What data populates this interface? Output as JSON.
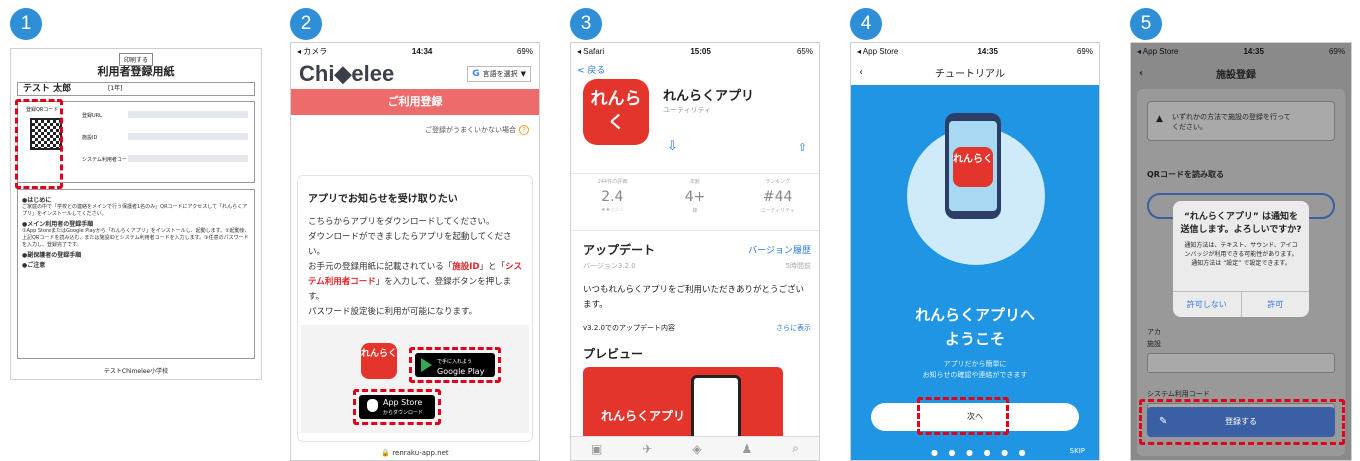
{
  "steps": [
    "1",
    "2",
    "3",
    "4",
    "5"
  ],
  "p1": {
    "print_button": "印刷する",
    "title": "利用者登録用紙",
    "user_name": "テスト 太郎",
    "user_tag": "[1年]",
    "qr_label": "登録QRコード",
    "field_1": "登録URL",
    "field_2": "施設ID",
    "field_3": "システム利用者コード",
    "intro_heading": "●はじめに",
    "intro_text": "ご家庭の中で「学校との連絡をメインで行う保護者1名のみ」QRコードにアクセスして「れんらくアプリ」をインストールしてください。",
    "main_heading": "●メイン利用者の登録手順",
    "main_text": "①App StoreまたはGoogle Playから「れんらくアプリ」をインストールし、起動します。②起動後、上記QRコードを読み込む、または施設IDとシステム利用者コードを入力します。③任意のパスワードを入力し、登録完了です。",
    "sub_heading": "●副保護者の登録手順",
    "note_heading": "●ご注意",
    "footer": "テストChimelee小学校"
  },
  "p2": {
    "time": "14:34",
    "carrier": "◂ カメラ",
    "battery": "69%",
    "logo": "Chi◆elee",
    "lang_button": "言語を選択",
    "header_bar": "ご利用登録",
    "help_link": "ご登録がうまくいかない場合",
    "card_title": "アプリでお知らせを受け取りたい",
    "para_1": "こちらからアプリをダウンロードしてください。",
    "para_2": "ダウンロードができましたらアプリを起動してください。",
    "para_3a": "お手元の登録用紙に記載されている「",
    "para_3_id": "施設ID",
    "para_3b": "」と「",
    "para_3_code": "システム利用者コード",
    "para_3c": "」を入力して、登録ボタンを押します。",
    "para_4": "パスワード設定後に利用が可能になります。",
    "app_icon": "れんらく",
    "google_play": "Google Play",
    "google_play_sub": "で手に入れよう",
    "app_store": "App Store",
    "app_store_sub": "からダウンロード",
    "url": "🔒 renraku-app.net"
  },
  "p3": {
    "time": "15:05",
    "carrier": "◂ Safari",
    "battery": "65%",
    "back": "< 戻る",
    "icon_text": "れんらく",
    "app_name": "れんらくアプリ",
    "category": "ユーティリティ",
    "stats": [
      {
        "label": "244件の評価",
        "value": "2.4",
        "sub": "★★☆☆☆"
      },
      {
        "label": "年齢",
        "value": "4+",
        "sub": "歳"
      },
      {
        "label": "ランキング",
        "value": "#44",
        "sub": "ユーティリティ"
      }
    ],
    "update_title": "アップデート",
    "history": "バージョン履歴",
    "version": "バージョン3.2.0",
    "ago": "5時間前",
    "note": "いつもれんらくアプリをご利用いただきありがとうございます。",
    "version_note": "v3.2.0でのアップデート内容",
    "more": "さらに表示",
    "preview": "プレビュー",
    "preview_text": "れんらくアプリ"
  },
  "p4": {
    "time": "14:35",
    "carrier": "◂ App Store",
    "battery": "69%",
    "nav_title": "チュートリアル",
    "app_logo": "れんらく",
    "welcome_1": "れんらくアプリへ",
    "welcome_2": "ようこそ",
    "sub_1": "アプリだから簡単に",
    "sub_2": "お知らせの確認や連絡ができます",
    "next_button": "次へ",
    "dots": "● ● ● ● ● ●",
    "skip": "SKIP"
  },
  "p5": {
    "time": "14:35",
    "carrier": "◂ App Store",
    "battery": "69%",
    "nav_title": "施設登録",
    "warning_1": "いずれかの方法で施設の登録を行って",
    "warning_2": "ください。",
    "qr_title": "QRコードを読み取る",
    "dialog_title_1": "“れんらくアプリ” は通知を",
    "dialog_title_2": "送信します。よろしいですか?",
    "dialog_body_1": "通知方法は、テキスト、サウンド、アイコ",
    "dialog_body_2": "ンバッジが利用できる可能性があります。",
    "dialog_body_3": "通知方法は “設定” で設定できます。",
    "deny": "許可しない",
    "allow": "許可",
    "account_label": "アカ",
    "facility_label": "施設",
    "code_label": "システム利用コード",
    "register_button": "登録する"
  }
}
